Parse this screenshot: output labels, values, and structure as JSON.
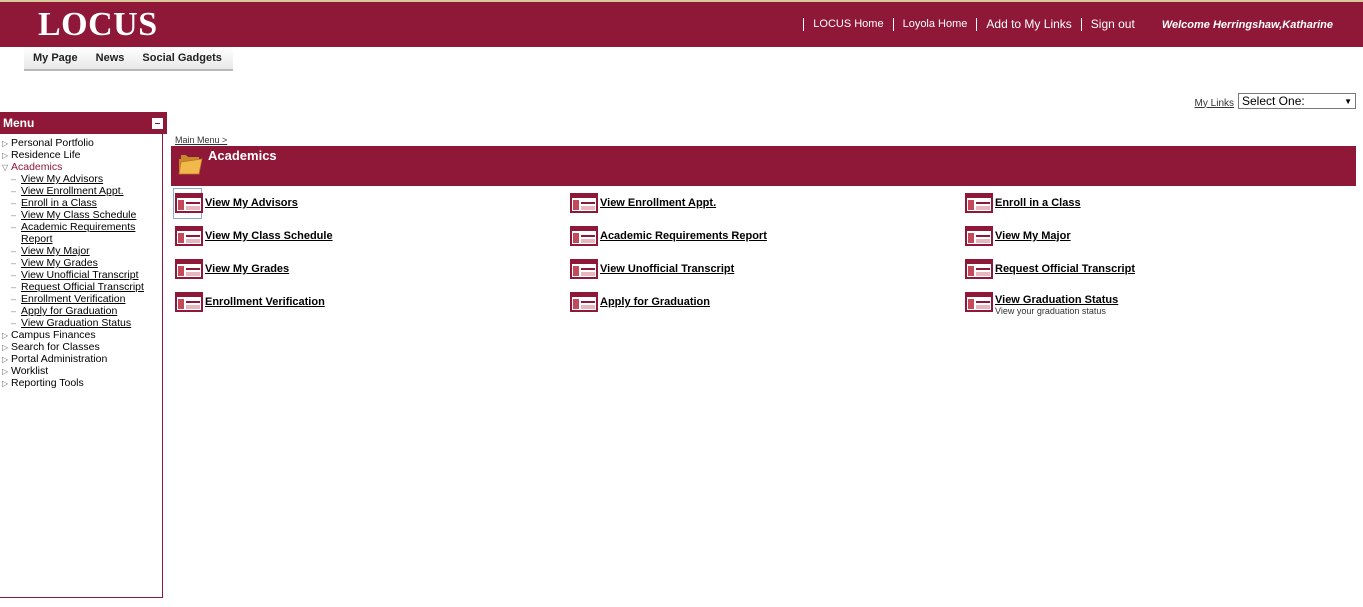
{
  "header": {
    "logo": "LOCUS",
    "links": [
      "LOCUS Home",
      "Loyola Home",
      "Add to My Links",
      "Sign out"
    ],
    "welcome": "Welcome Herringshaw,Katharine"
  },
  "tabs": [
    "My Page",
    "News",
    "Social Gadgets"
  ],
  "mylinks": {
    "label": "My Links",
    "select_value": "Select One:"
  },
  "menu": {
    "title": "Menu",
    "items": [
      {
        "label": "Personal Portfolio"
      },
      {
        "label": "Residence Life"
      },
      {
        "label": "Academics"
      },
      {
        "label": "Campus Finances"
      },
      {
        "label": "Search for Classes"
      },
      {
        "label": "Portal Administration"
      },
      {
        "label": "Worklist"
      },
      {
        "label": "Reporting Tools"
      }
    ],
    "academics_sub": [
      "View My Advisors",
      "View Enrollment Appt.",
      "Enroll in a Class",
      "View My Class Schedule",
      "Academic Requirements",
      "Report",
      "View My Major",
      "View My Grades",
      "View Unofficial Transcript",
      "Request Official Transcript",
      "Enrollment Verification",
      "Apply for Graduation",
      "View Graduation Status"
    ]
  },
  "breadcrumb": "Main Menu >",
  "page_title": "Academics",
  "links": [
    "View My Advisors",
    "View Enrollment Appt.",
    "Enroll in a Class",
    "View My Class Schedule",
    "Academic Requirements Report",
    "View My Major",
    "View My Grades",
    "View Unofficial Transcript",
    "Request Official Transcript",
    "Enrollment Verification",
    "Apply for Graduation",
    "View Graduation Status"
  ],
  "graduation_desc": "View your graduation status",
  "colors": {
    "brand": "#8f1838"
  }
}
